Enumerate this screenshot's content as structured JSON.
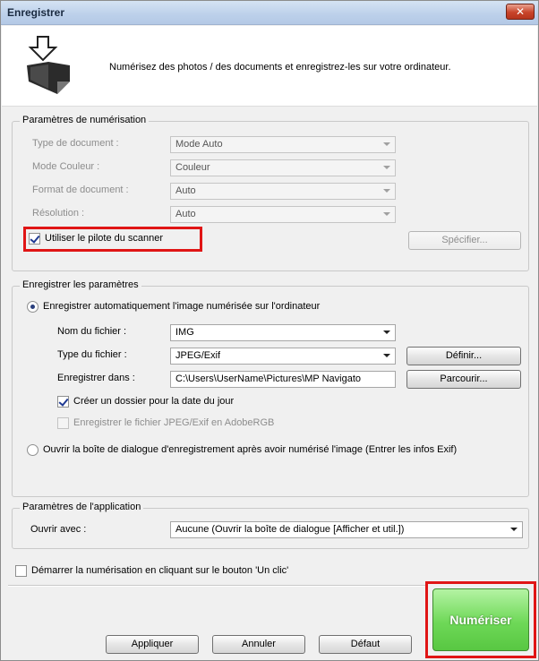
{
  "window": {
    "title": "Enregistrer",
    "close_label": "✕"
  },
  "header": {
    "description": "Numérisez des photos / des documents et enregistrez-les sur votre ordinateur."
  },
  "scan_settings": {
    "title": "Paramètres de numérisation",
    "document_type_label": "Type de document :",
    "document_type_value": "Mode Auto",
    "color_mode_label": "Mode Couleur :",
    "color_mode_value": "Couleur",
    "document_size_label": "Format de document :",
    "document_size_value": "Auto",
    "resolution_label": "Résolution :",
    "resolution_value": "Auto",
    "use_driver_label": "Utiliser le pilote du scanner",
    "use_driver_checked": true,
    "specify_button": "Spécifier..."
  },
  "save_settings": {
    "title": "Enregistrer les paramètres",
    "auto_save_label": "Enregistrer automatiquement l'image numérisée sur l'ordinateur",
    "file_name_label": "Nom du fichier :",
    "file_name_value": "IMG",
    "file_type_label": "Type du fichier :",
    "file_type_value": "JPEG/Exif",
    "define_button": "Définir...",
    "save_in_label": "Enregistrer dans :",
    "save_in_value": "C:\\Users\\UserName\\Pictures\\MP Navigato",
    "browse_button": "Parcourir...",
    "create_folder_label": "Créer un dossier pour la date du jour",
    "save_adobergb_label": "Enregistrer le fichier JPEG/Exif en AdobeRGB",
    "open_dialog_label": "Ouvrir la boîte de dialogue d'enregistrement après avoir numérisé l'image (Entrer les infos Exif)"
  },
  "app_settings": {
    "title": "Paramètres de l'application",
    "open_with_label": "Ouvrir avec :",
    "open_with_value": "Aucune (Ouvrir la boîte de dialogue [Afficher et util.])"
  },
  "one_click_label": "Démarrer la numérisation en cliquant sur le bouton 'Un clic'",
  "buttons": {
    "apply": "Appliquer",
    "cancel": "Annuler",
    "default": "Défaut",
    "scan": "Numériser"
  },
  "colors": {
    "highlight": "#e01515",
    "scan_button": "#6ed857"
  }
}
